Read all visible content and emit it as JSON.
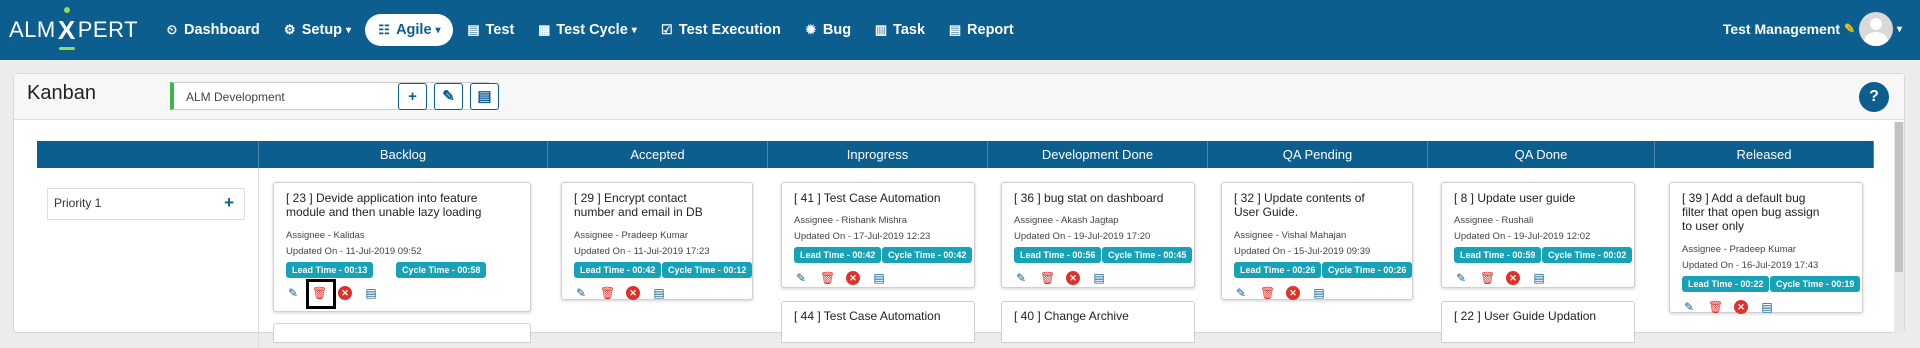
{
  "brand": {
    "prefix": "ALM",
    "x": "X",
    "suffix": "PERT"
  },
  "nav": [
    {
      "icon": "⏲",
      "label": "Dashboard",
      "caret": ""
    },
    {
      "icon": "⚙",
      "label": "Setup",
      "caret": "▾"
    },
    {
      "icon": "☷",
      "label": "Agile",
      "caret": "▾"
    },
    {
      "icon": "▤",
      "label": "Test",
      "caret": ""
    },
    {
      "icon": "▦",
      "label": "Test Cycle",
      "caret": "▾"
    },
    {
      "icon": "☑",
      "label": "Test Execution",
      "caret": ""
    },
    {
      "icon": "✹",
      "label": "Bug",
      "caret": ""
    },
    {
      "icon": "▥",
      "label": "Task",
      "caret": ""
    },
    {
      "icon": "▤",
      "label": "Report",
      "caret": ""
    }
  ],
  "user": {
    "name": "Test Management",
    "pencil": "✎",
    "caret": "▾"
  },
  "page": {
    "title": "Kanban",
    "project_select": "ALM Development",
    "select_caret": "▼",
    "add": "+",
    "edit": "✎",
    "doc": "▤",
    "help": "?"
  },
  "columns": [
    "Backlog",
    "Accepted",
    "Inprogress",
    "Development Done",
    "QA Pending",
    "QA Done",
    "Released"
  ],
  "lane": {
    "title": "Priority 1",
    "add": "+"
  },
  "icons": {
    "edit": "✎",
    "delete": "🗑",
    "close": "✕",
    "doc": "▤"
  },
  "cards": [
    {
      "title_1": "[ 23 ] Devide application into feature",
      "title_2": "module and then unable lazy loading",
      "assignee": "Assignee - Kalidas",
      "updated": "Updated On - 11-Jul-2019 09:52",
      "lead": "Lead Time - 00:13",
      "cycle": "Cycle Time - 00:58"
    },
    {
      "title_1": "[ 29 ] Encrypt contact",
      "title_2": "number and email in DB",
      "assignee": "Assignee - Pradeep Kumar",
      "updated": "Updated On - 11-Jul-2019 17:23",
      "lead": "Lead Time - 00:42",
      "cycle": "Cycle Time - 00:12"
    },
    {
      "title_1": "[ 41 ] Test Case Automation",
      "title_2": "",
      "assignee": "Assignee - Rishank Mishra",
      "updated": "Updated On - 17-Jul-2019 12:23",
      "lead": "Lead Time - 00:42",
      "cycle": "Cycle Time - 00:42"
    },
    {
      "title_1": "[ 36 ] bug stat on dashboard",
      "title_2": "",
      "assignee": "Assignee - Akash Jagtap",
      "updated": "Updated On - 19-Jul-2019 17:20",
      "lead": "Lead Time - 00:56",
      "cycle": "Cycle Time - 00:45"
    },
    {
      "title_1": "[ 32 ] Update contents of",
      "title_2": "User Guide.",
      "assignee": "Assignee - Vishal Mahajan",
      "updated": "Updated On - 15-Jul-2019 09:39",
      "lead": "Lead Time - 00:26",
      "cycle": "Cycle Time - 00:26"
    },
    {
      "title_1": "[ 8 ] Update user guide",
      "title_2": "",
      "assignee": "Assignee - Rushali",
      "updated": "Updated On - 19-Jul-2019 12:02",
      "lead": "Lead Time - 00:59",
      "cycle": "Cycle Time - 00:02"
    },
    {
      "title_1": "[ 39 ] Add a default bug",
      "title_2": "filter that open bug assign",
      "title_3": "to user only",
      "assignee": "Assignee - Pradeep Kumar",
      "updated": "Updated On - 16-Jul-2019 17:43",
      "lead": "Lead Time - 00:22",
      "cycle": "Cycle Time - 00:19"
    }
  ],
  "stubs": [
    "[ 44 ] Test Case Automation",
    "[ 40 ] Change Archive",
    "[ 22 ] User Guide Updation"
  ]
}
